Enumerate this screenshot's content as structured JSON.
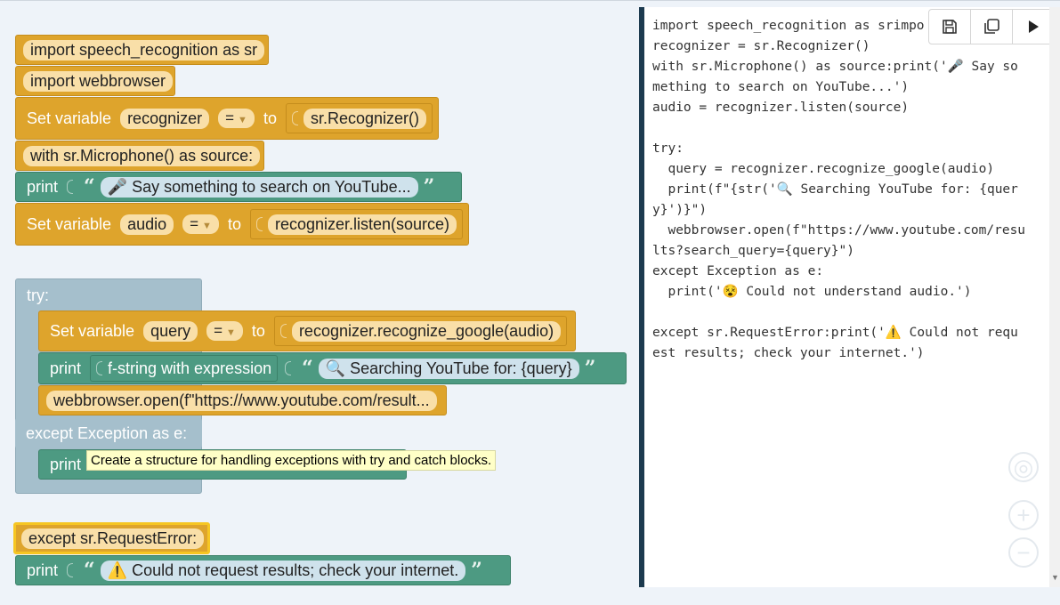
{
  "blocks": {
    "import_sr": "import speech_recognition as sr",
    "import_wb": "import webbrowser",
    "set_recognizer": {
      "label": "Set variable",
      "var": "recognizer",
      "op": "=",
      "to": "to",
      "value": "sr.Recognizer()"
    },
    "with_mic": "with sr.Microphone() as source:",
    "print1": {
      "label": "print",
      "text": "🎤 Say something to search on YouTube..."
    },
    "set_audio": {
      "label": "Set variable",
      "var": "audio",
      "op": "=",
      "to": "to",
      "value": "recognizer.listen(source)"
    },
    "try": "try:",
    "set_query": {
      "label": "Set variable",
      "var": "query",
      "op": "=",
      "to": "to",
      "value": "recognizer.recognize_google(audio)"
    },
    "print2": {
      "label": "print",
      "fstring": "f-string with expression",
      "text": "🔍 Searching YouTube for: {query}"
    },
    "webbrowser_open": "webbrowser.open(f\"https://www.youtube.com/result...",
    "except_exception": "except Exception as e:",
    "print3": {
      "label": "print"
    },
    "tooltip": "Create a structure for handling exceptions with try and catch blocks.",
    "except_request": "except sr.RequestError:",
    "print4": {
      "label": "print",
      "text": "⚠️ Could not request results; check your internet."
    }
  },
  "code": "import speech_recognition as srimpo\nrecognizer = sr.Recognizer()\nwith sr.Microphone() as source:print('🎤 Say so\nmething to search on YouTube...')\naudio = recognizer.listen(source)\n\ntry:\n  query = recognizer.recognize_google(audio)\n  print(f\"{str('🔍 Searching YouTube for: {quer\ny}')}\")\n  webbrowser.open(f\"https://www.youtube.com/resu\nlts?search_query={query}\")\nexcept Exception as e:\n  print('😵 Could not understand audio.')\n\nexcept sr.RequestError:print('⚠️ Could not requ\nest results; check your internet.')",
  "toolbar": [
    "save-icon",
    "copy-icon",
    "run-icon"
  ],
  "colors": {
    "orange": "#dea42c",
    "green": "#4d9a82",
    "grey": "#a5bfcc",
    "panel_border": "#1c3a4f"
  }
}
